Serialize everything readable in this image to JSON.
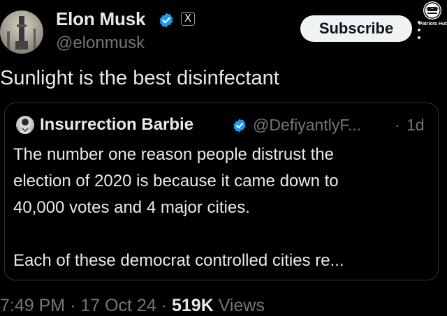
{
  "author": {
    "name": "Elon Musk",
    "handle": "@elonmusk",
    "verified_badge_color": "#1d9bf0",
    "affiliate_badge": "X"
  },
  "actions": {
    "subscribe_label": "Subscribe"
  },
  "watermark": {
    "text": "Patriots Hub"
  },
  "tweet": {
    "text": "Sunlight is the best disinfectant"
  },
  "quoted": {
    "name": "Insurrection Barbie",
    "handle": "@DefiyantlyF...",
    "separator": "·",
    "time": "1d",
    "lines": [
      "The number one reason people distrust the",
      "election of 2020 is because it came down to",
      "40,000 votes and 4 major cities."
    ],
    "line_after_gap": "Each of these democrat controlled cities re..."
  },
  "meta": {
    "time": "7:49 PM",
    "date": "17 Oct 24",
    "separator": "·",
    "views_count": "519K",
    "views_label": "Views"
  },
  "colors": {
    "background": "#000000",
    "text_primary": "#e7e9ea",
    "text_secondary": "#71767b",
    "border": "#2f3336",
    "button_bg": "#eff3f4"
  }
}
